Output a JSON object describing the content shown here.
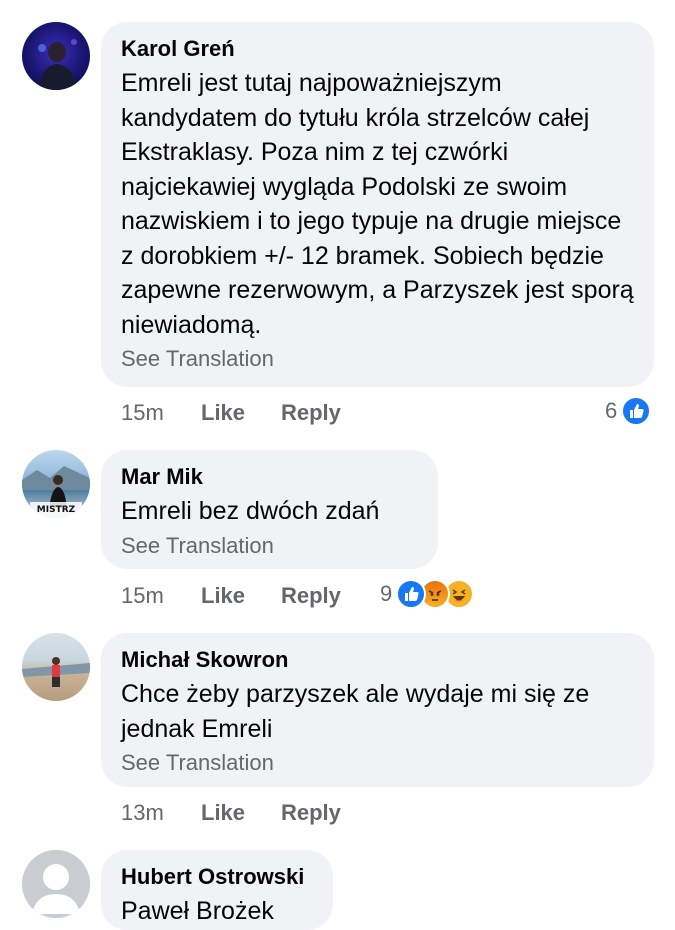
{
  "comments": [
    {
      "author": "Karol Greń",
      "text": "Emreli jest tutaj najpoważniejszym kandydatem do tytułu króla strzelców całej Ekstraklasy. Poza nim z tej czwórki najciekawiej wygląda Podolski ze swoim nazwiskiem i to jego typuje na drugie miejsce z dorobkiem +/- 12 bramek. Sobiech będzie zapewne rezerwowym, a Parzyszek jest sporą niewiadomą.",
      "see_translation": "See Translation",
      "time": "15m",
      "like": "Like",
      "reply": "Reply",
      "reaction_count": "6",
      "reactions": [
        "like-icon"
      ]
    },
    {
      "author": "Mar Mik",
      "avatar_caption": "MISTRZ",
      "text": "Emreli bez dwóch zdań",
      "see_translation": "See Translation",
      "time": "15m",
      "like": "Like",
      "reply": "Reply",
      "reaction_count": "9",
      "reactions": [
        "like-icon",
        "angry-icon",
        "haha-icon"
      ]
    },
    {
      "author": "Michał Skowron",
      "text": "Chce żeby parzyszek ale wydaje mi się ze jednak Emreli",
      "see_translation": "See Translation",
      "time": "13m",
      "like": "Like",
      "reply": "Reply"
    },
    {
      "author": "Hubert Ostrowski",
      "text": "Paweł Brożek"
    }
  ],
  "colors": {
    "like": "#1877f2",
    "angry": "#e9710f",
    "haha": "#f7b125",
    "bubble": "#f0f2f5",
    "secondary_text": "#65676b"
  }
}
